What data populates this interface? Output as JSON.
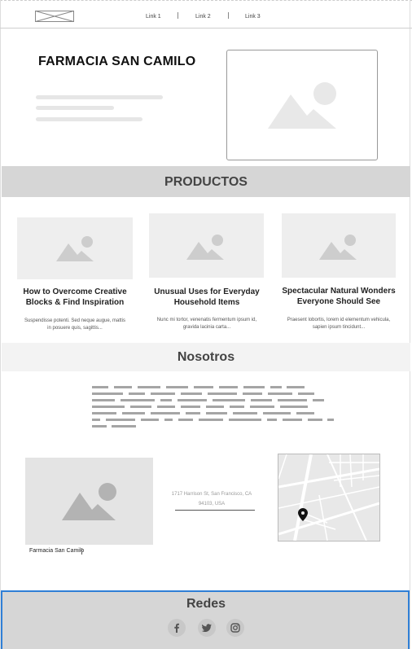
{
  "nav": {
    "links": [
      "Link 1",
      "Link 2",
      "Link 3"
    ]
  },
  "hero": {
    "title": "FARMACIA SAN CAMILO"
  },
  "productos": {
    "title": "PRODUCTOS",
    "cards": [
      {
        "title_line1": "How to Overcome Creative",
        "title_line2": "Blocks & Find Inspiration",
        "text_line1": "Suspendisse potenti. Sed neque augue, mattis",
        "text_line2": "in posuere quis, sagittis..."
      },
      {
        "title_line1": "Unusual Uses for Everyday",
        "title_line2": "Household Items",
        "text_line1": "Nunc mi tortor, venenatis fermentum ipsum id,",
        "text_line2": "gravida lacinia carta..."
      },
      {
        "title_line1": "Spectacular Natural Wonders",
        "title_line2": "Everyone Should See",
        "text_line1": "Praesent lobortis, lorem id elementum vehicula,",
        "text_line2": "sapien ipsum tincidunt..."
      }
    ]
  },
  "nosotros": {
    "title": "Nosotros",
    "image_caption": "Farmacia San Camilo",
    "address_line1": "1717 Harrison St, San Francisco, CA",
    "address_line2": "94103, USA"
  },
  "redes": {
    "title": "Redes",
    "icons": [
      "facebook-icon",
      "twitter-icon",
      "instagram-icon"
    ]
  },
  "colors": {
    "band": "#d6d6d6",
    "placeholder": "#eeeeee",
    "selection_border": "#2f7fd6"
  }
}
